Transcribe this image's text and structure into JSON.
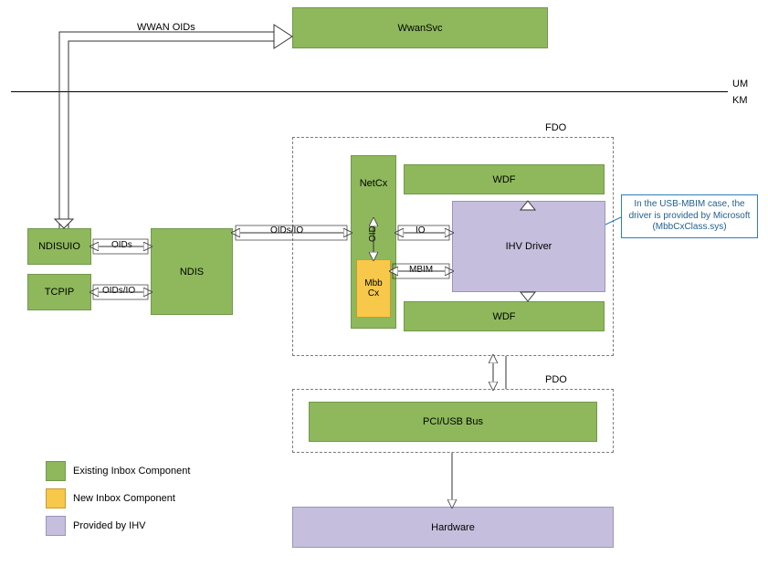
{
  "top": {
    "arrow_label": "WWAN OIDs",
    "service": "WwanSvc"
  },
  "modes": {
    "um": "UM",
    "km": "KM"
  },
  "left": {
    "ndisuio": "NDISUIO",
    "tcpip": "TCPIP",
    "ndis": "NDIS",
    "arrow_oids": "OIDs",
    "arrow_oids_io": "OIDs/IO"
  },
  "fdo": {
    "label": "FDO",
    "netcx": "NetCx",
    "wdf_top": "WDF",
    "wdf_bottom": "WDF",
    "mbbcx": "Mbb\nCx",
    "ihv": "IHV Driver",
    "arrow_oids_io": "OIDs/IO",
    "arrow_io": "IO",
    "arrow_oid": "OID",
    "arrow_mbim": "MBIM"
  },
  "callout": "In the USB-MBIM case, the\ndriver is provided by Microsoft\n(MbbCxClass.sys)",
  "pdo": {
    "label": "PDO",
    "bus": "PCI/USB Bus"
  },
  "hardware": "Hardware",
  "legend": {
    "existing": "Existing Inbox Component",
    "new": "New Inbox Component",
    "ihv": "Provided by IHV"
  }
}
